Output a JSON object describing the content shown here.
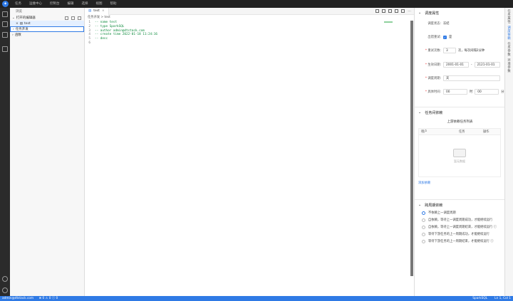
{
  "menu": [
    "任务",
    "运维中心",
    "控制台",
    "编辑",
    "选择",
    "视图",
    "帮助"
  ],
  "sidebar": {
    "header": "浏览",
    "open_editors": "打开的编辑器",
    "open_file": "test",
    "task_dev": "任务开发",
    "function": "函数"
  },
  "editor": {
    "tab": "test",
    "breadcrumb": "任务开发 > test",
    "lines": [
      {
        "n": "1",
        "t": "-- name test"
      },
      {
        "n": "2",
        "t": "-- type SparkSQL"
      },
      {
        "n": "3",
        "t": "-- author admin@dtstack.com"
      },
      {
        "n": "4",
        "t": "-- create time 2022-01-18 11:24:16"
      },
      {
        "n": "5",
        "t": "-- desc"
      },
      {
        "n": "6",
        "t": ""
      }
    ]
  },
  "panel": {
    "schedule": {
      "title": "调度属性",
      "status_label": "调度状态:",
      "status_value": "冻结",
      "retry_label": "出错重试:",
      "retry_value": "是",
      "retry_count_label": "重试次数:",
      "retry_count": "3",
      "retry_suffix": "次，每次间隔2分钟",
      "effective_label": "生效日期:",
      "start_date": "2001-01-01",
      "end_date": "2121-01-01",
      "cycle_label": "调度周期:",
      "cycle_value": "天",
      "time_label": "具体时间:",
      "hour": "00",
      "hour_unit": "时",
      "minute": "00",
      "minute_unit": "分"
    },
    "deps": {
      "title": "任务间依赖",
      "table_title": "上游依赖任务列表",
      "col_tenant": "租户",
      "col_task": "任务",
      "col_op": "操作",
      "empty": "暂无数据",
      "add": "添加依赖"
    },
    "cross": {
      "title": "跨周期依赖",
      "options": [
        "不依赖上一调度周期",
        "自依赖，等待上一调度周期成功，才能继续运行",
        "自依赖，等待上一调度周期结束，才能继续运行 ⓘ",
        "等待下游任务的上一周期成功，才能继续运行",
        "等待下游任务的上一周期结束，才能继续运行 ⓘ"
      ]
    }
  },
  "right_tabs": [
    "任务属性",
    "调度依赖",
    "任务参数",
    "环境参数"
  ],
  "status": {
    "user": "admin@dtstack.com",
    "counts": "⊗ 0 ⚠ 0 ⓘ 0",
    "lang": "SparkSQL",
    "pos": "Ln 1, Col 1"
  }
}
